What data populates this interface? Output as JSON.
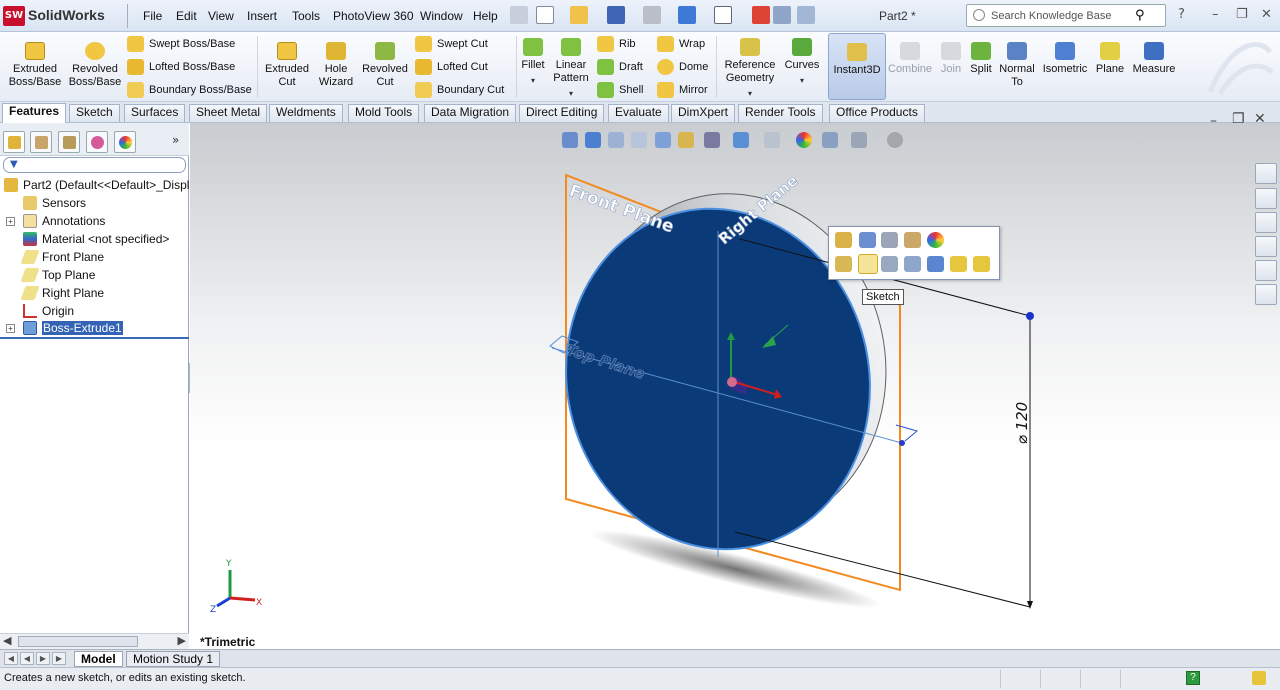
{
  "app": {
    "name": "SolidWorks",
    "logo_text": "SW",
    "document_title": "Part2 *"
  },
  "menu": [
    "File",
    "Edit",
    "View",
    "Insert",
    "Tools",
    "PhotoView 360",
    "Window",
    "Help"
  ],
  "search": {
    "placeholder": "Search Knowledge Base"
  },
  "ribbon": {
    "extruded_boss": "Extruded Boss/Base",
    "revolved_boss": "Revolved Boss/Base",
    "swept_boss": "Swept Boss/Base",
    "lofted_boss": "Lofted Boss/Base",
    "boundary_boss": "Boundary Boss/Base",
    "extruded_cut": "Extruded Cut",
    "hole_wizard": "Hole Wizard",
    "revolved_cut": "Revolved Cut",
    "swept_cut": "Swept Cut",
    "lofted_cut": "Lofted Cut",
    "boundary_cut": "Boundary Cut",
    "fillet": "Fillet",
    "linear_pattern": "Linear Pattern",
    "rib": "Rib",
    "draft": "Draft",
    "shell": "Shell",
    "wrap": "Wrap",
    "dome": "Dome",
    "mirror": "Mirror",
    "reference_geometry": "Reference Geometry",
    "curves": "Curves",
    "instant3d": "Instant3D",
    "combine": "Combine",
    "join": "Join",
    "split": "Split",
    "normal_to": "Normal To",
    "isometric": "Isometric",
    "plane": "Plane",
    "measure": "Measure"
  },
  "tabs": [
    "Features",
    "Sketch",
    "Surfaces",
    "Sheet Metal",
    "Weldments",
    "Mold Tools",
    "Data Migration",
    "Direct Editing",
    "Evaluate",
    "DimXpert",
    "Render Tools",
    "Office Products"
  ],
  "tree": [
    {
      "label": "Part2  (Default<<Default>_Displa"
    },
    {
      "label": "Sensors"
    },
    {
      "label": "Annotations"
    },
    {
      "label": "Material <not specified>"
    },
    {
      "label": "Front Plane"
    },
    {
      "label": "Top Plane"
    },
    {
      "label": "Right Plane"
    },
    {
      "label": "Origin"
    },
    {
      "label": "Boss-Extrude1"
    }
  ],
  "viewport": {
    "front_plane": "Front Plane",
    "right_plane": "Right Plane",
    "top_plane": "Top Plane",
    "dimension": "⌀ 120",
    "view_label": "*Trimetric",
    "tooltip": "Sketch",
    "triad_x": "X",
    "triad_y": "Y",
    "triad_z": "Z",
    "colors": {
      "face": "#0b3a78",
      "edge": "#4b8fe0",
      "plane": "#f28a1f"
    }
  },
  "bottom_tabs": [
    "Model",
    "Motion Study 1"
  ],
  "status_text": "Creates a new sketch, or edits an existing sketch."
}
